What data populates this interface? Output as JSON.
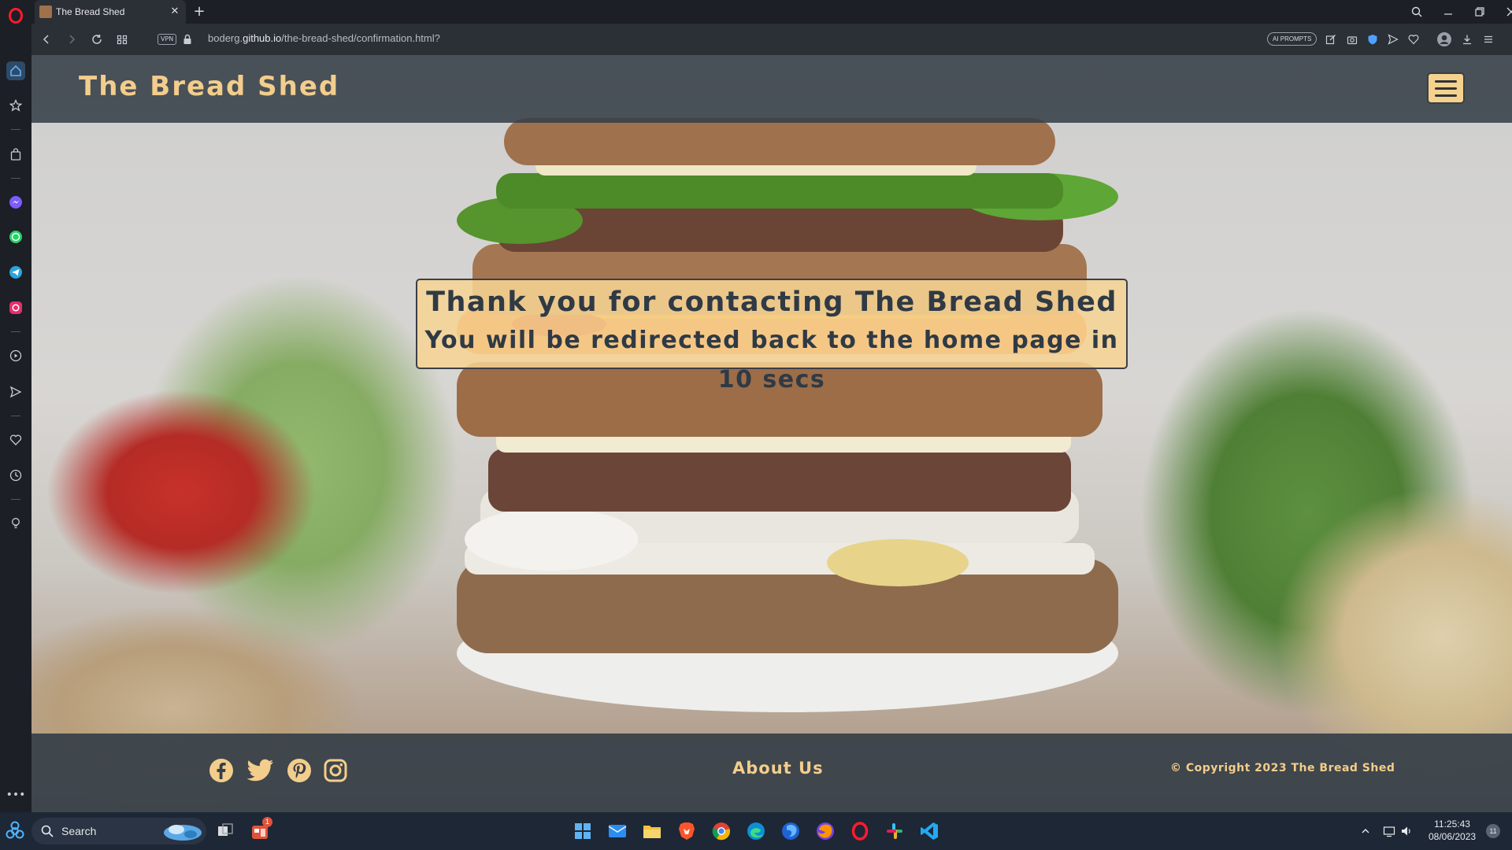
{
  "browser": {
    "tab_title": "The Bread Shed",
    "new_tab": "+",
    "close_tab": "✕",
    "vpn": "VPN",
    "url_prefix": "boderg.",
    "url_domain": "github.io",
    "url_path": "/the-bread-shed/confirmation.html?",
    "ai_prompts": "AI PROMPTS"
  },
  "site": {
    "title": "The Bread Shed",
    "message_line1": "Thank you for contacting The Bread Shed",
    "message_line2": "You will be redirected back to the home page in 10 secs",
    "about": "About Us",
    "copyright": "Copyright 2023 The Bread Shed",
    "accent_color": "#f3cd8c",
    "header_color": "#353f48"
  },
  "social_icons": [
    "facebook-icon",
    "twitter-icon",
    "pinterest-icon",
    "instagram-icon"
  ],
  "taskbar": {
    "search_label": "Search",
    "time": "11:25:43",
    "date": "08/06/2023",
    "notification_badge": "1",
    "notification_count": "11"
  }
}
